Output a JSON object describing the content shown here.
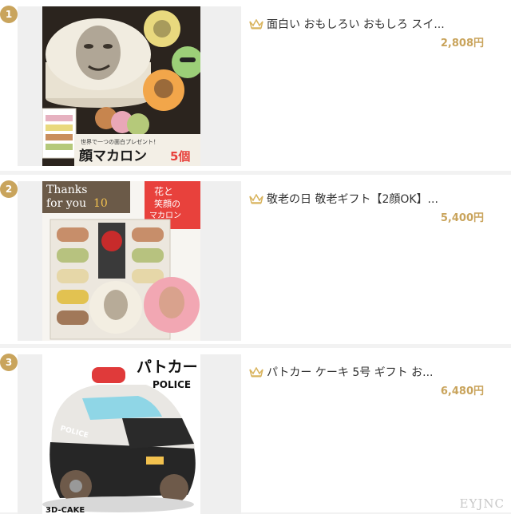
{
  "items": [
    {
      "rank": "1",
      "title": "面白い おもしろい おもしろ スイ...",
      "price": "2,808円",
      "image_caption_small": "世界で一つの面白プレゼント！",
      "image_caption": "顔マカロン",
      "image_caption_count": "5個"
    },
    {
      "rank": "2",
      "title": "敬老の日 敬老ギフト【2顔OK】...",
      "price": "5,400円",
      "image_text_thanks": "Thanks",
      "image_text_for_you": "for you",
      "image_text_number": "10",
      "image_badge_line1": "花と",
      "image_badge_line2": "笑顔の",
      "image_badge_line3": "マカロン"
    },
    {
      "rank": "3",
      "title": "パトカー ケーキ 5号 ギフト お...",
      "price": "6,480円",
      "image_text_title": "パトカー",
      "image_text_police": "POLICE",
      "image_text_car_label": "POLICE",
      "image_text_bottom": "3D-CAKE"
    }
  ],
  "watermark": "EYJNC",
  "colors": {
    "rank_badge": "#c9a45c",
    "price": "#c9a45c",
    "crown": "#d9b45e",
    "badge_red": "#e8413c"
  },
  "icons": {
    "rank_crown": "crown-icon"
  }
}
